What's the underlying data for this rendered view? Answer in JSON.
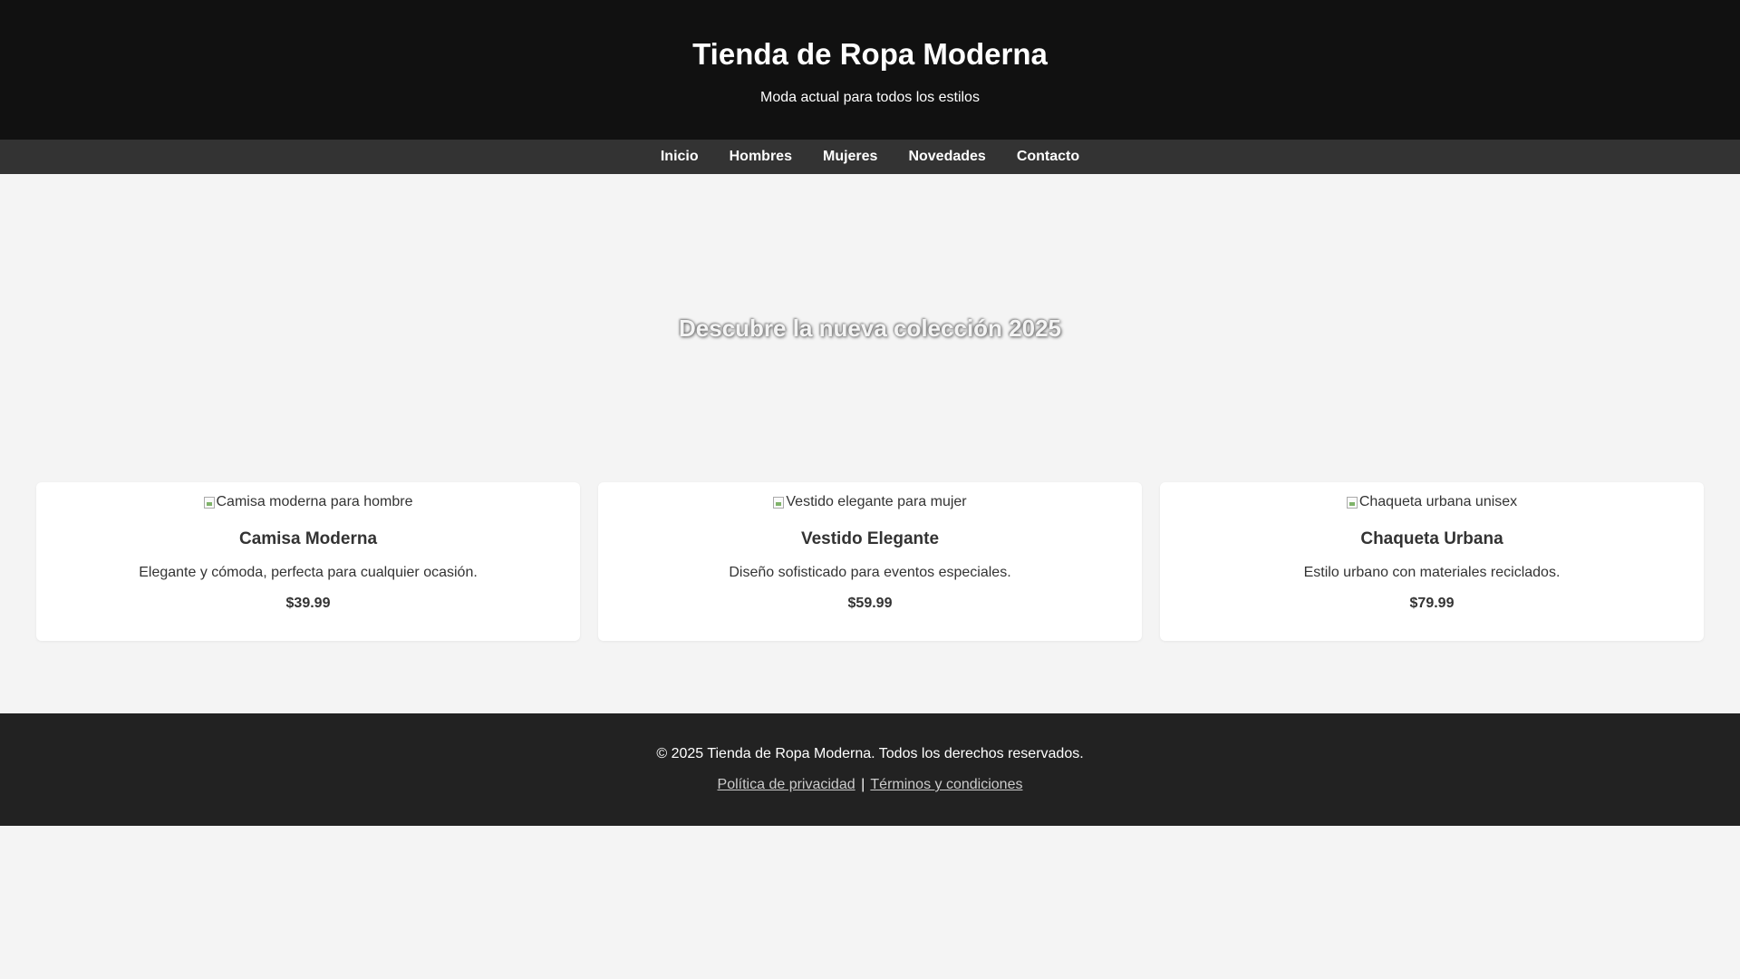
{
  "header": {
    "title": "Tienda de Ropa Moderna",
    "tagline": "Moda actual para todos los estilos"
  },
  "nav": {
    "items": [
      {
        "label": "Inicio"
      },
      {
        "label": "Hombres"
      },
      {
        "label": "Mujeres"
      },
      {
        "label": "Novedades"
      },
      {
        "label": "Contacto"
      }
    ]
  },
  "hero": {
    "text": "Descubre la nueva colección 2025"
  },
  "products": [
    {
      "image_alt": "Camisa moderna para hombre",
      "name": "Camisa Moderna",
      "description": "Elegante y cómoda, perfecta para cualquier ocasión.",
      "price": "$39.99"
    },
    {
      "image_alt": "Vestido elegante para mujer",
      "name": "Vestido Elegante",
      "description": "Diseño sofisticado para eventos especiales.",
      "price": "$59.99"
    },
    {
      "image_alt": "Chaqueta urbana unisex",
      "name": "Chaqueta Urbana",
      "description": "Estilo urbano con materiales reciclados.",
      "price": "$79.99"
    }
  ],
  "footer": {
    "copyright": "© 2025 Tienda de Ropa Moderna. Todos los derechos reservados.",
    "privacy_label": "Política de privacidad",
    "separator": "|",
    "terms_label": "Términos y condiciones"
  },
  "colors": {
    "header_bg": "#111111",
    "nav_bg": "#333333",
    "page_bg": "#f4f4f4",
    "footer_bg": "#222222",
    "card_bg": "#ffffff"
  },
  "icons": {
    "product_image": "broken-image-icon"
  }
}
